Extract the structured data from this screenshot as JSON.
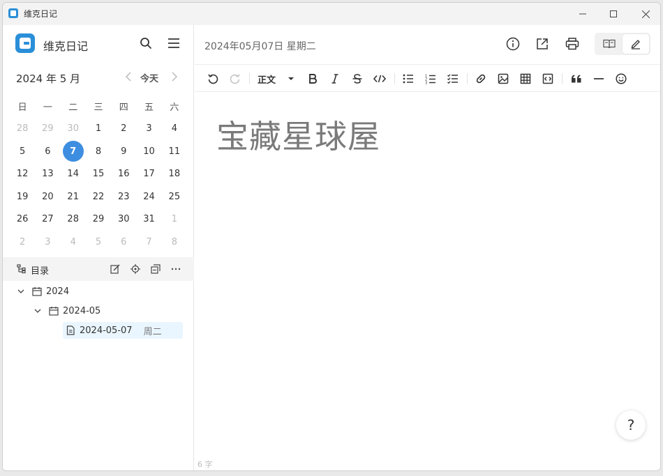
{
  "window": {
    "title": "维克日记"
  },
  "sidebar": {
    "app_name": "维克日记",
    "month_title": "2024 年 5 月",
    "today_label": "今天",
    "weekdays": [
      "日",
      "一",
      "二",
      "三",
      "四",
      "五",
      "六"
    ],
    "weeks": [
      [
        "28",
        "29",
        "30",
        "1",
        "2",
        "3",
        "4"
      ],
      [
        "5",
        "6",
        "7",
        "8",
        "9",
        "10",
        "11"
      ],
      [
        "12",
        "13",
        "14",
        "15",
        "16",
        "17",
        "18"
      ],
      [
        "19",
        "20",
        "21",
        "22",
        "23",
        "24",
        "25"
      ],
      [
        "26",
        "27",
        "28",
        "29",
        "30",
        "31",
        "1"
      ],
      [
        "2",
        "3",
        "4",
        "5",
        "6",
        "7",
        "8"
      ]
    ],
    "dir_title": "目录",
    "tree": {
      "year": "2024",
      "month": "2024-05",
      "entry_date": "2024-05-07",
      "entry_weekday": "周二"
    }
  },
  "main": {
    "date_heading": "2024年05月07日 星期二",
    "toolbar": {
      "paragraph_label": "正文"
    },
    "editor_title": "宝藏星球屋",
    "word_count": "6 字",
    "help_label": "?"
  }
}
